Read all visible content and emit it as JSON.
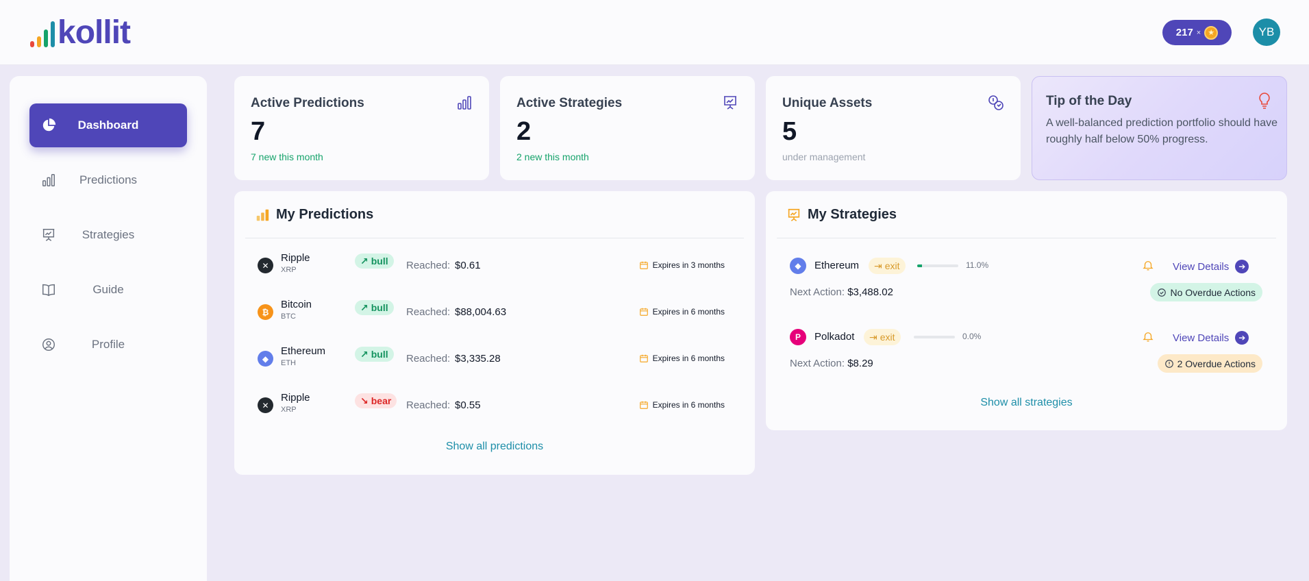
{
  "header": {
    "logo_text": "kollit",
    "coins": "217",
    "coins_times": "×",
    "avatar_initials": "YB"
  },
  "sidebar": {
    "items": [
      {
        "label": "Dashboard",
        "icon": "pie-chart-icon",
        "active": true
      },
      {
        "label": "Predictions",
        "icon": "bar-chart-icon"
      },
      {
        "label": "Strategies",
        "icon": "presentation-chart-icon"
      },
      {
        "label": "Guide",
        "icon": "book-icon"
      },
      {
        "label": "Profile",
        "icon": "user-circle-icon"
      }
    ]
  },
  "stats": [
    {
      "title": "Active Predictions",
      "value": "7",
      "sub": "7 new this month",
      "icon": "bar-chart-icon"
    },
    {
      "title": "Active Strategies",
      "value": "2",
      "sub": "2 new this month",
      "icon": "presentation-chart-icon"
    },
    {
      "title": "Unique Assets",
      "value": "5",
      "sub": "under management",
      "icon": "coins-icon"
    }
  ],
  "tip": {
    "title": "Tip of the Day",
    "text": "A well-balanced prediction portfolio should have roughly half below 50% progress."
  },
  "predictions": {
    "title": "My Predictions",
    "reached_label": "Reached:",
    "rows": [
      {
        "name": "Ripple",
        "symbol": "XRP",
        "trend": "bull",
        "reached": "$0.61",
        "expires": "Expires in 3 months"
      },
      {
        "name": "Bitcoin",
        "symbol": "BTC",
        "trend": "bull",
        "reached": "$88,004.63",
        "expires": "Expires in 6 months"
      },
      {
        "name": "Ethereum",
        "symbol": "ETH",
        "trend": "bull",
        "reached": "$3,335.28",
        "expires": "Expires in 6 months"
      },
      {
        "name": "Ripple",
        "symbol": "XRP",
        "trend": "bear",
        "reached": "$0.55",
        "expires": "Expires in 6 months"
      }
    ],
    "show_all": "Show all predictions"
  },
  "strategies": {
    "title": "My Strategies",
    "next_action_label": "Next Action:",
    "view_details": "View Details",
    "rows": [
      {
        "name": "Ethereum",
        "tag": "exit",
        "progress": "11.0%",
        "progress_value": 0.11,
        "next_action": "$3,488.02",
        "overdue": "No Overdue Actions",
        "overdue_state": "ok"
      },
      {
        "name": "Polkadot",
        "tag": "exit",
        "progress": "0.0%",
        "progress_value": 0.0,
        "next_action": "$8.29",
        "overdue": "2 Overdue Actions",
        "overdue_state": "warn"
      }
    ],
    "show_all": "Show all strategies"
  },
  "colors": {
    "brand": "#4f46b8",
    "accent_teal": "#1d8ea8",
    "success": "#16a36b",
    "danger": "#dc2626",
    "warning": "#d89a2b"
  }
}
